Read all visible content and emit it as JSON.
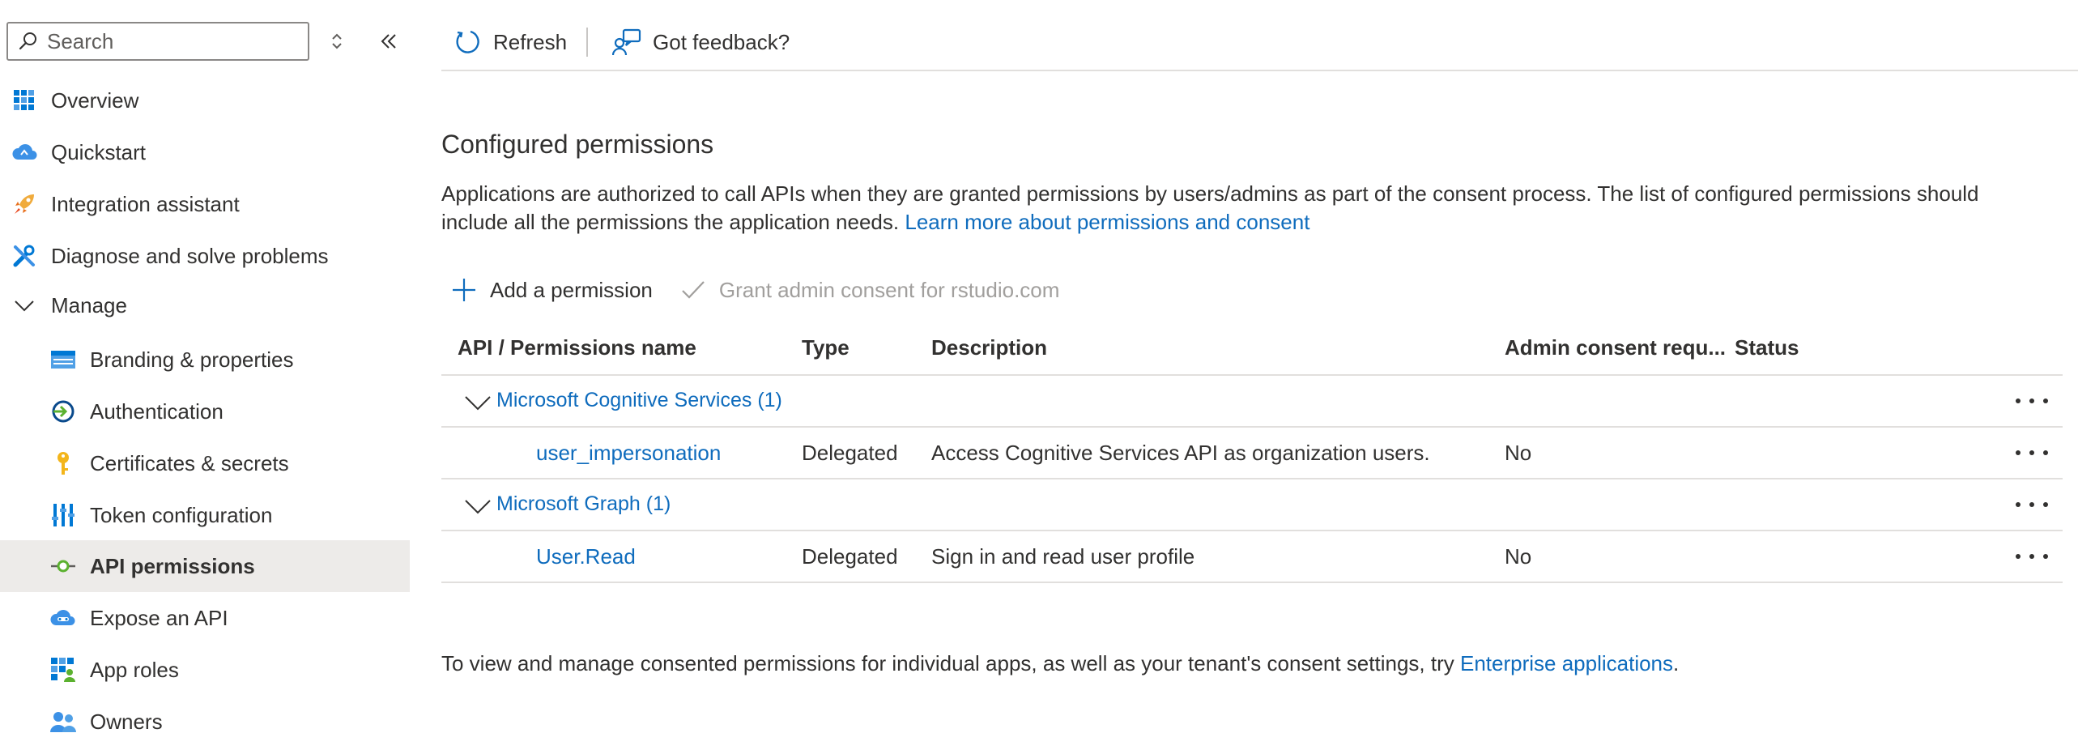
{
  "sidebar": {
    "search_placeholder": "Search",
    "items": [
      {
        "label": "Overview",
        "icon": "overview-grid-icon"
      },
      {
        "label": "Quickstart",
        "icon": "quickstart-cloud-icon"
      },
      {
        "label": "Integration assistant",
        "icon": "rocket-icon"
      },
      {
        "label": "Diagnose and solve problems",
        "icon": "wrench-icon"
      },
      {
        "label": "Manage",
        "icon": "chevron-down-icon"
      },
      {
        "label": "Branding & properties",
        "icon": "branding-icon"
      },
      {
        "label": "Authentication",
        "icon": "authentication-icon"
      },
      {
        "label": "Certificates & secrets",
        "icon": "key-icon"
      },
      {
        "label": "Token configuration",
        "icon": "token-bars-icon"
      },
      {
        "label": "API permissions",
        "icon": "api-permissions-icon"
      },
      {
        "label": "Expose an API",
        "icon": "cloud-api-icon"
      },
      {
        "label": "App roles",
        "icon": "app-roles-icon"
      },
      {
        "label": "Owners",
        "icon": "owners-icon"
      }
    ],
    "selected_index": 9
  },
  "toolbar": {
    "refresh_label": "Refresh",
    "feedback_label": "Got feedback?"
  },
  "content": {
    "title": "Configured permissions",
    "intro_text": "Applications are authorized to call APIs when they are granted permissions by users/admins as part of the consent process. The list of configured permissions should include all the permissions the application needs.",
    "intro_link": "Learn more about permissions and consent",
    "add_permission_label": "Add a permission",
    "grant_consent_label": "Grant admin consent for rstudio.com",
    "table": {
      "headers": {
        "name": "API / Permissions name",
        "type": "Type",
        "description": "Description",
        "admin_consent": "Admin consent requ...",
        "status": "Status"
      },
      "groups": [
        {
          "name": "Microsoft Cognitive Services (1)",
          "permissions": [
            {
              "name": "user_impersonation",
              "type": "Delegated",
              "description": "Access Cognitive Services API as organization users.",
              "admin_consent": "No",
              "status": ""
            }
          ]
        },
        {
          "name": "Microsoft Graph (1)",
          "permissions": [
            {
              "name": "User.Read",
              "type": "Delegated",
              "description": "Sign in and read user profile",
              "admin_consent": "No",
              "status": ""
            }
          ]
        }
      ]
    },
    "footer_text": "To view and manage consented permissions for individual apps, as well as your tenant's consent settings, try",
    "footer_link": "Enterprise applications",
    "footer_end": "."
  },
  "colors": {
    "accent": "#0f6cbd",
    "selected_bg": "#edebe9",
    "divider": "#e1dfdd",
    "disabled_text": "#a19f9d"
  }
}
